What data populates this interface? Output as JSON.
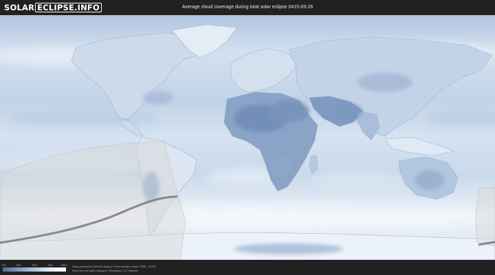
{
  "header": {
    "logo_part1": "SOLAR",
    "logo_part2": "ECLIPSE",
    "logo_part3": ".INFO",
    "title": "Average cloud coverage during total solar eclipse 0415-03-26"
  },
  "map": {
    "projection": "equirectangular world",
    "ocean_color": "#c9d8ec",
    "land_cloudy_color": "#dfe8f4",
    "clear_region_color": "#6f8cb6",
    "eclipse_band_color": "#d8d8d8",
    "central_line_color": "#7a7a7a"
  },
  "legend": {
    "ticks": [
      "0%",
      "25%",
      "50%",
      "75%",
      "100%"
    ],
    "colors": [
      "#4f6f98",
      "#7e9bc0",
      "#b3c6de",
      "#e3ebf5",
      "#ffffff"
    ]
  },
  "footer": {
    "credit_line1": "Data provided by NASA's Aqua & Terra satellite (Years: 2000 - 2019)",
    "credit_line2": "https://neo.sci.gsfc.nasa.gov | Resolution: 0.1 degrees"
  }
}
